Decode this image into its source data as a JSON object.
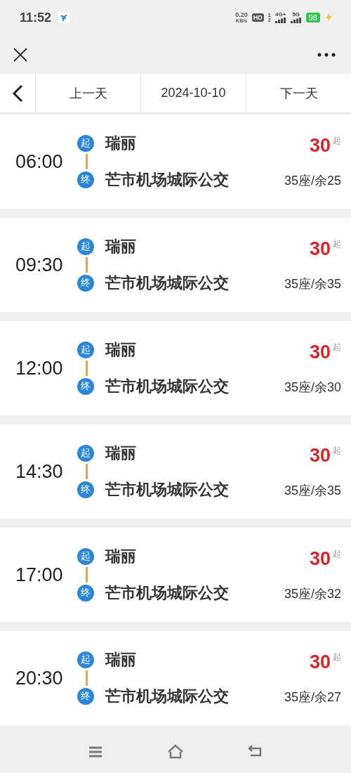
{
  "status_bar": {
    "time": "11:52",
    "speed_value": "0.20",
    "speed_unit": "KB/s",
    "hd": "HD",
    "sims": [
      "1",
      "2"
    ],
    "network_1": "4G+",
    "network_2": "5G",
    "battery": "98"
  },
  "date_nav": {
    "prev": "上一天",
    "date": "2024-10-10",
    "next": "下一天"
  },
  "trips": [
    {
      "time": "06:00",
      "start_badge": "起",
      "from": "瑞丽",
      "end_badge": "终",
      "to": "芒市机场城际公交",
      "price": "30",
      "price_suffix": "起",
      "seats": "35座/余25"
    },
    {
      "time": "09:30",
      "start_badge": "起",
      "from": "瑞丽",
      "end_badge": "终",
      "to": "芒市机场城际公交",
      "price": "30",
      "price_suffix": "起",
      "seats": "35座/余35"
    },
    {
      "time": "12:00",
      "start_badge": "起",
      "from": "瑞丽",
      "end_badge": "终",
      "to": "芒市机场城际公交",
      "price": "30",
      "price_suffix": "起",
      "seats": "35座/余30"
    },
    {
      "time": "14:30",
      "start_badge": "起",
      "from": "瑞丽",
      "end_badge": "终",
      "to": "芒市机场城际公交",
      "price": "30",
      "price_suffix": "起",
      "seats": "35座/余35"
    },
    {
      "time": "17:00",
      "start_badge": "起",
      "from": "瑞丽",
      "end_badge": "终",
      "to": "芒市机场城际公交",
      "price": "30",
      "price_suffix": "起",
      "seats": "35座/余32"
    },
    {
      "time": "20:30",
      "start_badge": "起",
      "from": "瑞丽",
      "end_badge": "终",
      "to": "芒市机场城际公交",
      "price": "30",
      "price_suffix": "起",
      "seats": "35座/余27"
    }
  ]
}
